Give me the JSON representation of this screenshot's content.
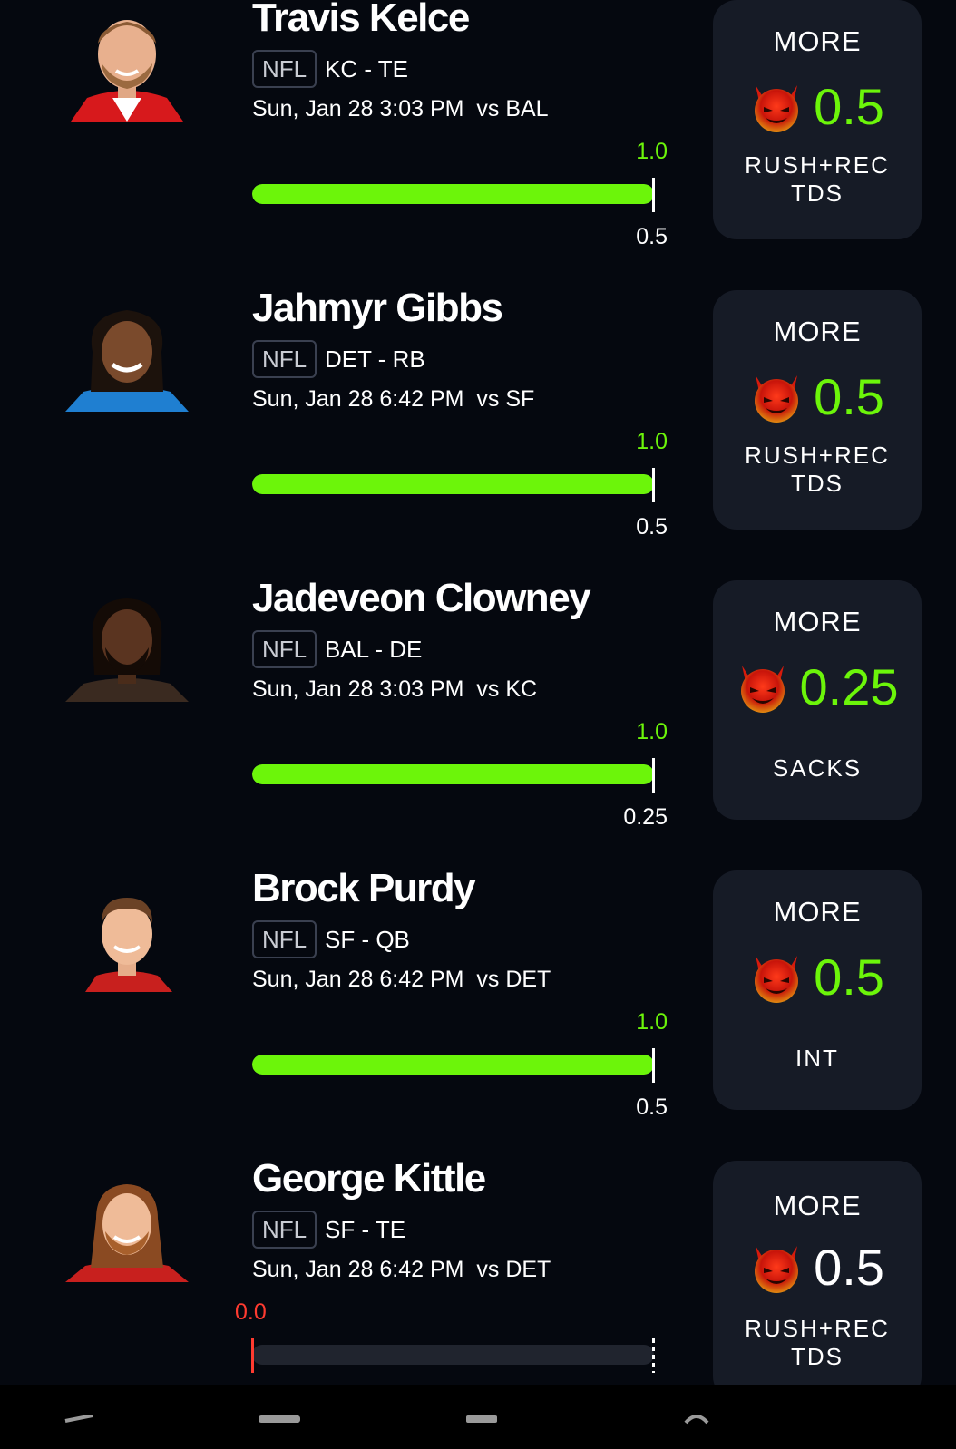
{
  "entries": [
    {
      "name": "Travis Kelce",
      "league": "NFL",
      "team_pos": "KC - TE",
      "game": "Sun, Jan 28 3:03 PM  vs BAL",
      "actual": "1.0",
      "target": "0.5",
      "progress": 1.0,
      "pick": {
        "direction": "MORE",
        "line": "0.5",
        "stat": "RUSH+REC\nTDS",
        "color": "#6cf50a"
      },
      "jersey_color": "#d7191c"
    },
    {
      "name": "Jahmyr Gibbs",
      "league": "NFL",
      "team_pos": "DET - RB",
      "game": "Sun, Jan 28 6:42 PM  vs SF",
      "actual": "1.0",
      "target": "0.5",
      "progress": 1.0,
      "pick": {
        "direction": "MORE",
        "line": "0.5",
        "stat": "RUSH+REC\nTDS",
        "color": "#6cf50a"
      },
      "jersey_color": "#1f7fd1"
    },
    {
      "name": "Jadeveon Clowney",
      "league": "NFL",
      "team_pos": "BAL - DE",
      "game": "Sun, Jan 28 3:03 PM  vs KC",
      "actual": "1.0",
      "target": "0.25",
      "progress": 1.0,
      "pick": {
        "direction": "MORE",
        "line": "0.25",
        "stat": "SACKS",
        "color": "#6cf50a"
      },
      "jersey_color": "#3a2a20"
    },
    {
      "name": "Brock Purdy",
      "league": "NFL",
      "team_pos": "SF - QB",
      "game": "Sun, Jan 28 6:42 PM  vs DET",
      "actual": "1.0",
      "target": "0.5",
      "progress": 1.0,
      "pick": {
        "direction": "MORE",
        "line": "0.5",
        "stat": "INT",
        "color": "#6cf50a"
      },
      "jersey_color": "#c8201e"
    },
    {
      "name": "George Kittle",
      "league": "NFL",
      "team_pos": "SF - TE",
      "game": "Sun, Jan 28 6:42 PM  vs DET",
      "actual": "0.0",
      "target": "",
      "progress": 0.0,
      "pick": {
        "direction": "MORE",
        "line": "0.5",
        "stat": "RUSH+REC\nTDS",
        "color": "#ffffff"
      },
      "jersey_color": "#c8201e"
    }
  ],
  "colors": {
    "background": "#05080f",
    "card": "#161b26",
    "progress_fill": "#6cf50a",
    "progress_track": "#20242e",
    "miss": "#ff3b30"
  },
  "icons": {
    "pick": "devil-icon",
    "avatar": "player-headshot"
  }
}
